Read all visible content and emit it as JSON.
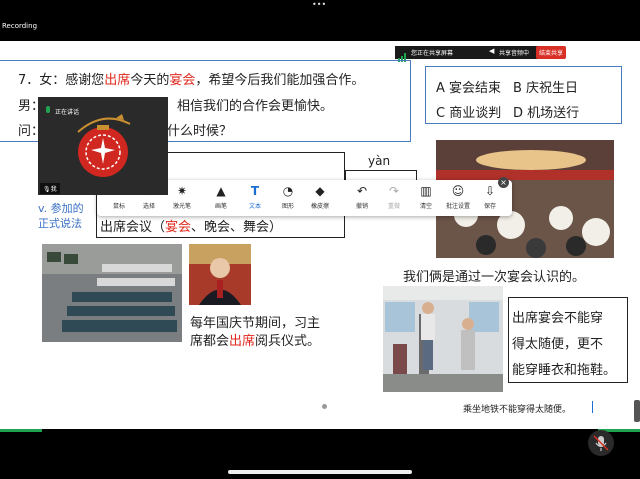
{
  "recording_label": "Recording",
  "top_dots": "•••",
  "share_bar": {
    "status": "您正在共享屏幕",
    "audio": "共享音频中",
    "stop": "结束共享"
  },
  "question": {
    "num": "7．女：",
    "p1": "感谢您",
    "h1": "出席",
    "p2": "今天的",
    "h2": "宴会",
    "p3": "，希望今后我们能加强合作。",
    "line2_prefix": "男：",
    "line2_text": "相信我们的合作会更愉快。",
    "line3_prefix": "问：",
    "line3_text": "什么时候？"
  },
  "options": {
    "a": "A 宴会结束",
    "b": "B 庆祝生日",
    "c": "C 商业谈判",
    "d": "D 机场送行"
  },
  "pinyin": "yàn",
  "vocab_note": {
    "line1": "v. 参加的",
    "line2": "正式说法"
  },
  "phrase": {
    "pre": "出席会议（",
    "hl": "宴会",
    "post": "、晚会、舞会）"
  },
  "sentence_banquet": "我们俩是通过一次宴会认识的。",
  "sentence_parade": {
    "line1": "每年国庆节期间，习主",
    "line2_pre": "席都会",
    "line2_hl": "出席",
    "line2_post": "阅兵仪式。"
  },
  "sentence_dress": {
    "line1": "出席宴会不能穿",
    "line2": "得太随便，更不",
    "line3": "能穿睡衣和拖鞋。"
  },
  "subway_note": "乘坐地铁不能穿得太随便。",
  "participant": {
    "status": "正在讲话",
    "name": "我"
  },
  "toolbar": {
    "tools": [
      {
        "label": "鼠标",
        "icon": "cursor-icon"
      },
      {
        "label": "选择",
        "icon": "move-icon"
      },
      {
        "label": "激光笔",
        "icon": "laser-pointer-icon"
      },
      {
        "label": "画笔",
        "icon": "pen-icon"
      },
      {
        "label": "文本",
        "icon": "text-icon"
      },
      {
        "label": "图形",
        "icon": "shape-icon"
      },
      {
        "label": "橡皮擦",
        "icon": "eraser-icon"
      },
      {
        "label": "撤销",
        "icon": "undo-icon"
      },
      {
        "label": "重做",
        "icon": "redo-icon"
      },
      {
        "label": "清空",
        "icon": "trash-icon"
      },
      {
        "label": "批注设置",
        "icon": "annotation-settings-icon"
      },
      {
        "label": "保存",
        "icon": "save-icon"
      }
    ],
    "text_glyph": "T"
  }
}
